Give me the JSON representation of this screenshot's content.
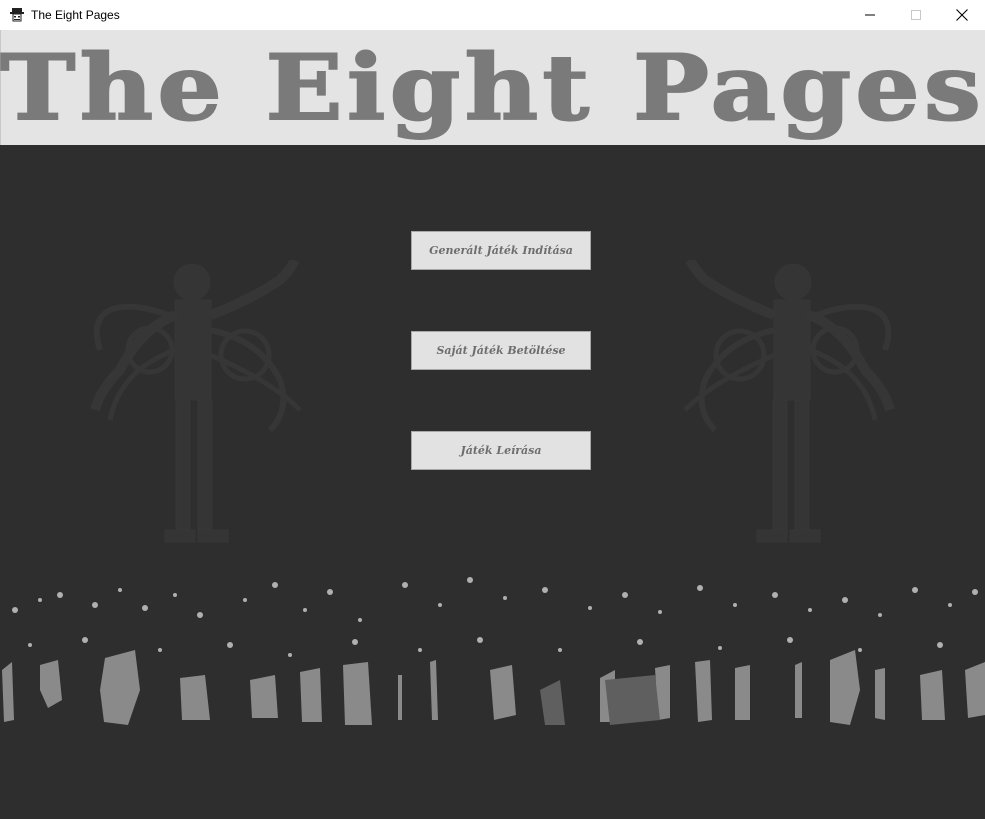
{
  "window": {
    "title": "The Eight Pages",
    "icon": "hat-face-icon"
  },
  "banner": {
    "title": "The Eight Pages"
  },
  "menu": {
    "buttons": [
      {
        "label": "Generált Játék Indítása"
      },
      {
        "label": "Saját Játék Betöltése"
      },
      {
        "label": "Játék Leírása"
      }
    ]
  },
  "colors": {
    "background": "#2e2e2e",
    "banner": "#e4e4e4",
    "title_text": "#7a7a7a",
    "button_bg": "#e2e2e2",
    "button_text": "#6e6e6e"
  }
}
